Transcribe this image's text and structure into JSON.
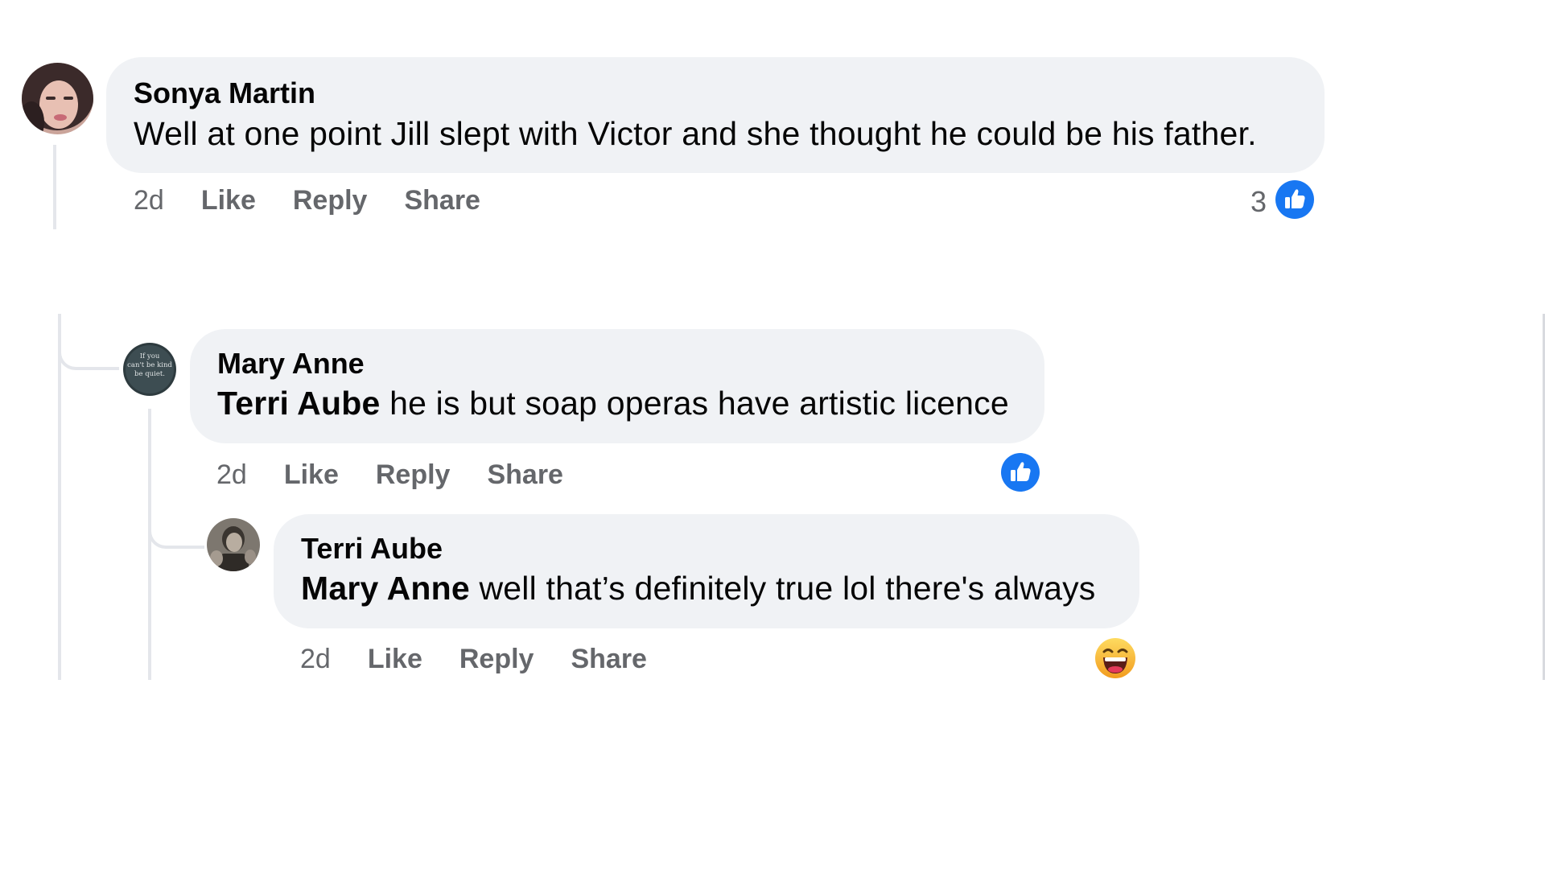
{
  "comments": [
    {
      "author": "Sonya Martin",
      "mention": "",
      "text": "Well at one point Jill slept with Victor and she thought he could be his father.",
      "time": "2d",
      "like_label": "Like",
      "reply_label": "Reply",
      "share_label": "Share",
      "reaction_count": "3",
      "reaction_icon": "like-icon",
      "reaction_color": "#1877f2"
    },
    {
      "author": "Mary Anne",
      "mention": "Terri Aube",
      "text": " he is but soap operas have artistic licence",
      "time": "2d",
      "like_label": "Like",
      "reply_label": "Reply",
      "share_label": "Share",
      "avatar_text": [
        "If you",
        "can't be kind",
        "be quiet."
      ],
      "reaction_icon": "like-icon",
      "reaction_color": "#1877f2"
    },
    {
      "author": "Terri Aube",
      "mention": "Mary Anne",
      "text": " well that’s definitely true lol there's always",
      "time": "2d",
      "like_label": "Like",
      "reply_label": "Reply",
      "share_label": "Share",
      "reaction_icon": "haha-emoji",
      "reaction_color": "#f7b125"
    }
  ],
  "colors": {
    "bubble": "#f0f2f5",
    "thread_line": "#e4e6eb",
    "secondary_text": "#65676b",
    "like_blue": "#1877f2"
  }
}
